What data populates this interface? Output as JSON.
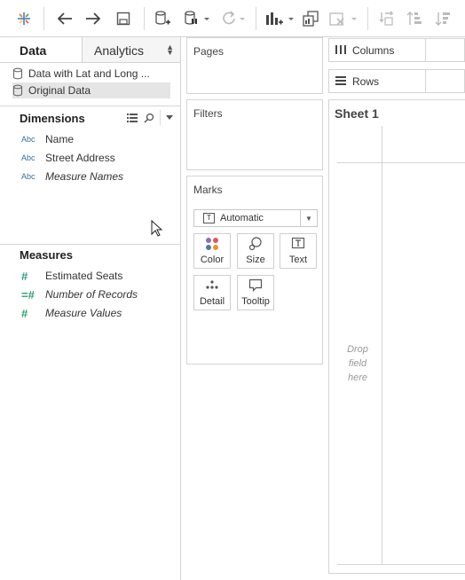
{
  "toolbar": {
    "icons": [
      "tableau-logo-icon",
      "back-arrow-icon",
      "forward-arrow-icon",
      "save-icon",
      "new-datasource-icon",
      "pause-datasource-icon",
      "refresh-icon",
      "new-worksheet-icon",
      "duplicate-sheet-icon",
      "clear-sheet-icon",
      "swap-rows-columns-icon",
      "sort-ascending-icon",
      "sort-descending-icon"
    ]
  },
  "left_pane": {
    "tabs": {
      "data": "Data",
      "analytics": "Analytics"
    },
    "data_sources": [
      {
        "label": "Data with Lat and Long ...",
        "selected": false
      },
      {
        "label": "Original Data",
        "selected": true
      }
    ],
    "dimensions": {
      "title": "Dimensions",
      "fields": [
        {
          "type": "Abc",
          "name": "Name"
        },
        {
          "type": "Abc",
          "name": "Street Address"
        },
        {
          "type": "Abc",
          "name": "Measure Names"
        }
      ]
    },
    "measures": {
      "title": "Measures",
      "fields": [
        {
          "type": "#",
          "name": "Estimated Seats"
        },
        {
          "type": "=#",
          "name": "Number of Records"
        },
        {
          "type": "#",
          "name": "Measure Values"
        }
      ]
    }
  },
  "cards": {
    "pages": "Pages",
    "filters": "Filters",
    "marks": {
      "title": "Marks",
      "mark_type": "Automatic",
      "buttons": {
        "color": "Color",
        "size": "Size",
        "text": "Text",
        "detail": "Detail",
        "tooltip": "Tooltip"
      }
    }
  },
  "shelves": {
    "columns": "Columns",
    "rows": "Rows"
  },
  "sheet": {
    "title": "Sheet 1",
    "drop_hint": [
      "Drop",
      "field",
      "here"
    ]
  },
  "colors": {
    "accent": "#3a6f99",
    "measure_green": "#2e9e6f",
    "border": "#d4d4d4"
  }
}
